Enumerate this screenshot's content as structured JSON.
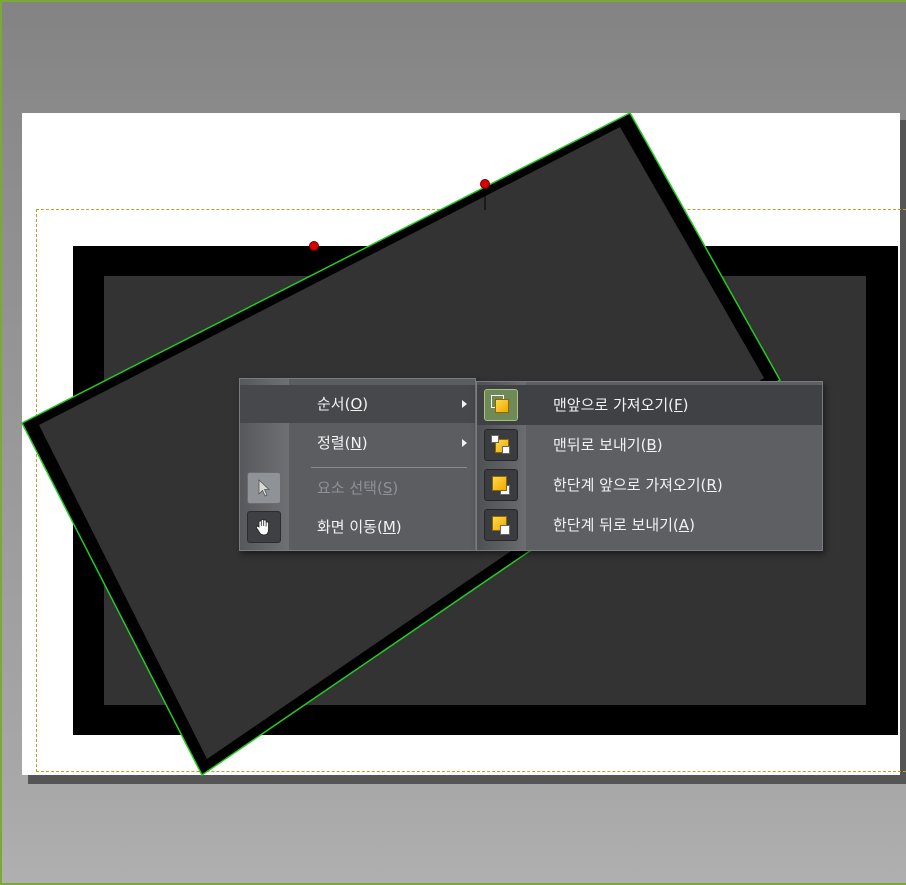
{
  "context_menu": {
    "items": [
      {
        "label": "순서(O)",
        "has_submenu": true,
        "state": "hover"
      },
      {
        "label": "정렬(N)",
        "has_submenu": true
      },
      {
        "label": "요소 선택(S)",
        "state": "disabled",
        "icon": "pointer-icon"
      },
      {
        "label": "화면 이동(M)",
        "icon": "hand-pan-icon"
      }
    ]
  },
  "order_submenu": {
    "items": [
      {
        "label": "맨앞으로 가져오기(F)",
        "icon": "bring-to-front-icon",
        "state": "hover"
      },
      {
        "label": "맨뒤로 보내기(B)",
        "icon": "send-to-back-icon"
      },
      {
        "label": "한단계 앞으로 가져오기(R)",
        "icon": "bring-forward-icon"
      },
      {
        "label": "한단계 뒤로 보내기(A)",
        "icon": "send-backward-icon"
      }
    ]
  },
  "colors": {
    "selection_outline": "#22cc22",
    "margin_guide": "#c99a2e",
    "handle": "#dd0000",
    "icon_yellow": "#f5b800"
  }
}
